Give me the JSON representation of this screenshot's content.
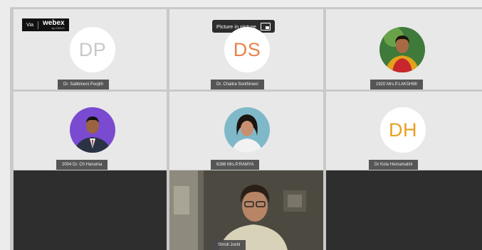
{
  "app": {
    "badge_via": "Via",
    "badge_brand": "webex",
    "badge_sub": "by CISCO",
    "pip_label": "Picture in picture"
  },
  "tiles": [
    {
      "name": "Dr. Sabbineni Poojith",
      "initials": "DP",
      "initials_color": "#c8c8c8"
    },
    {
      "name": "Dr. Chaitra Sonthineni",
      "initials": "DS",
      "initials_color": "#e8824a"
    },
    {
      "name": "1920 Mrs.P.LAKSHMI",
      "photo": "woman-portrait"
    },
    {
      "name": "2004 Dr. Ch Hanuma",
      "photo": "man-portrait"
    },
    {
      "name": "6286 Mrs.P.RAMYA",
      "photo": "woman-portrait"
    },
    {
      "name": "Dr Kola Hemamalini",
      "initials": "DH",
      "initials_color": "#e6a020"
    },
    {
      "name": "",
      "video": false
    },
    {
      "name": "Shruti Joshi",
      "video": true
    },
    {
      "name": "",
      "video": false
    }
  ]
}
